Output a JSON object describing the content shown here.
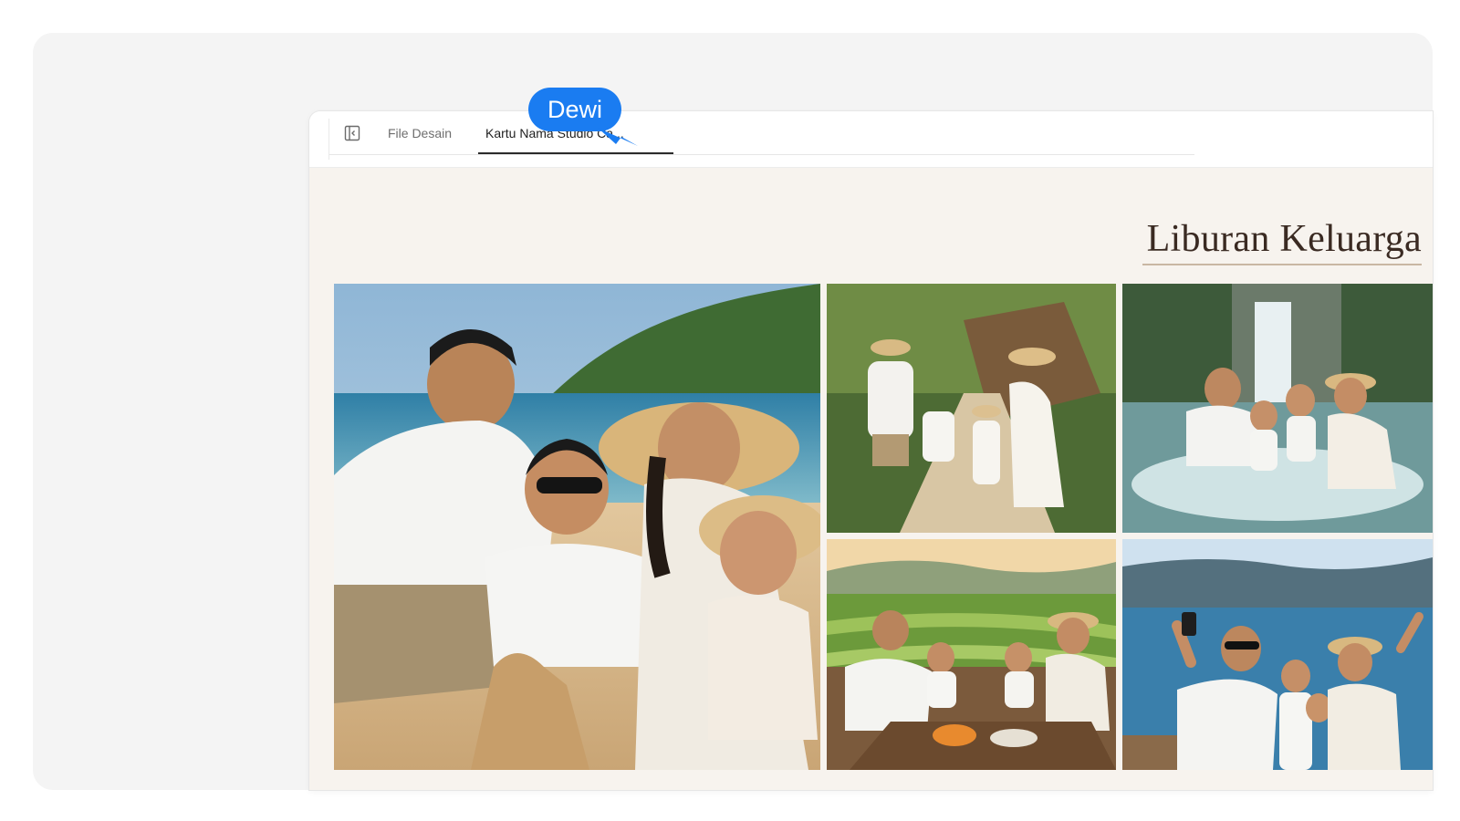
{
  "tabs": {
    "files_label": "File Desain",
    "active_label": "Kartu Nama Studio Ca..."
  },
  "icons": {
    "sidebar_toggle": "sidebar-toggle-icon"
  },
  "document": {
    "title": "Liburan Keluarga"
  },
  "collaborator": {
    "name": "Dewi",
    "color": "#1a7cf1"
  },
  "colors": {
    "canvas": "#f7f3ee",
    "title": "#3a2a22",
    "accent_underline": "#c9b7a3"
  }
}
